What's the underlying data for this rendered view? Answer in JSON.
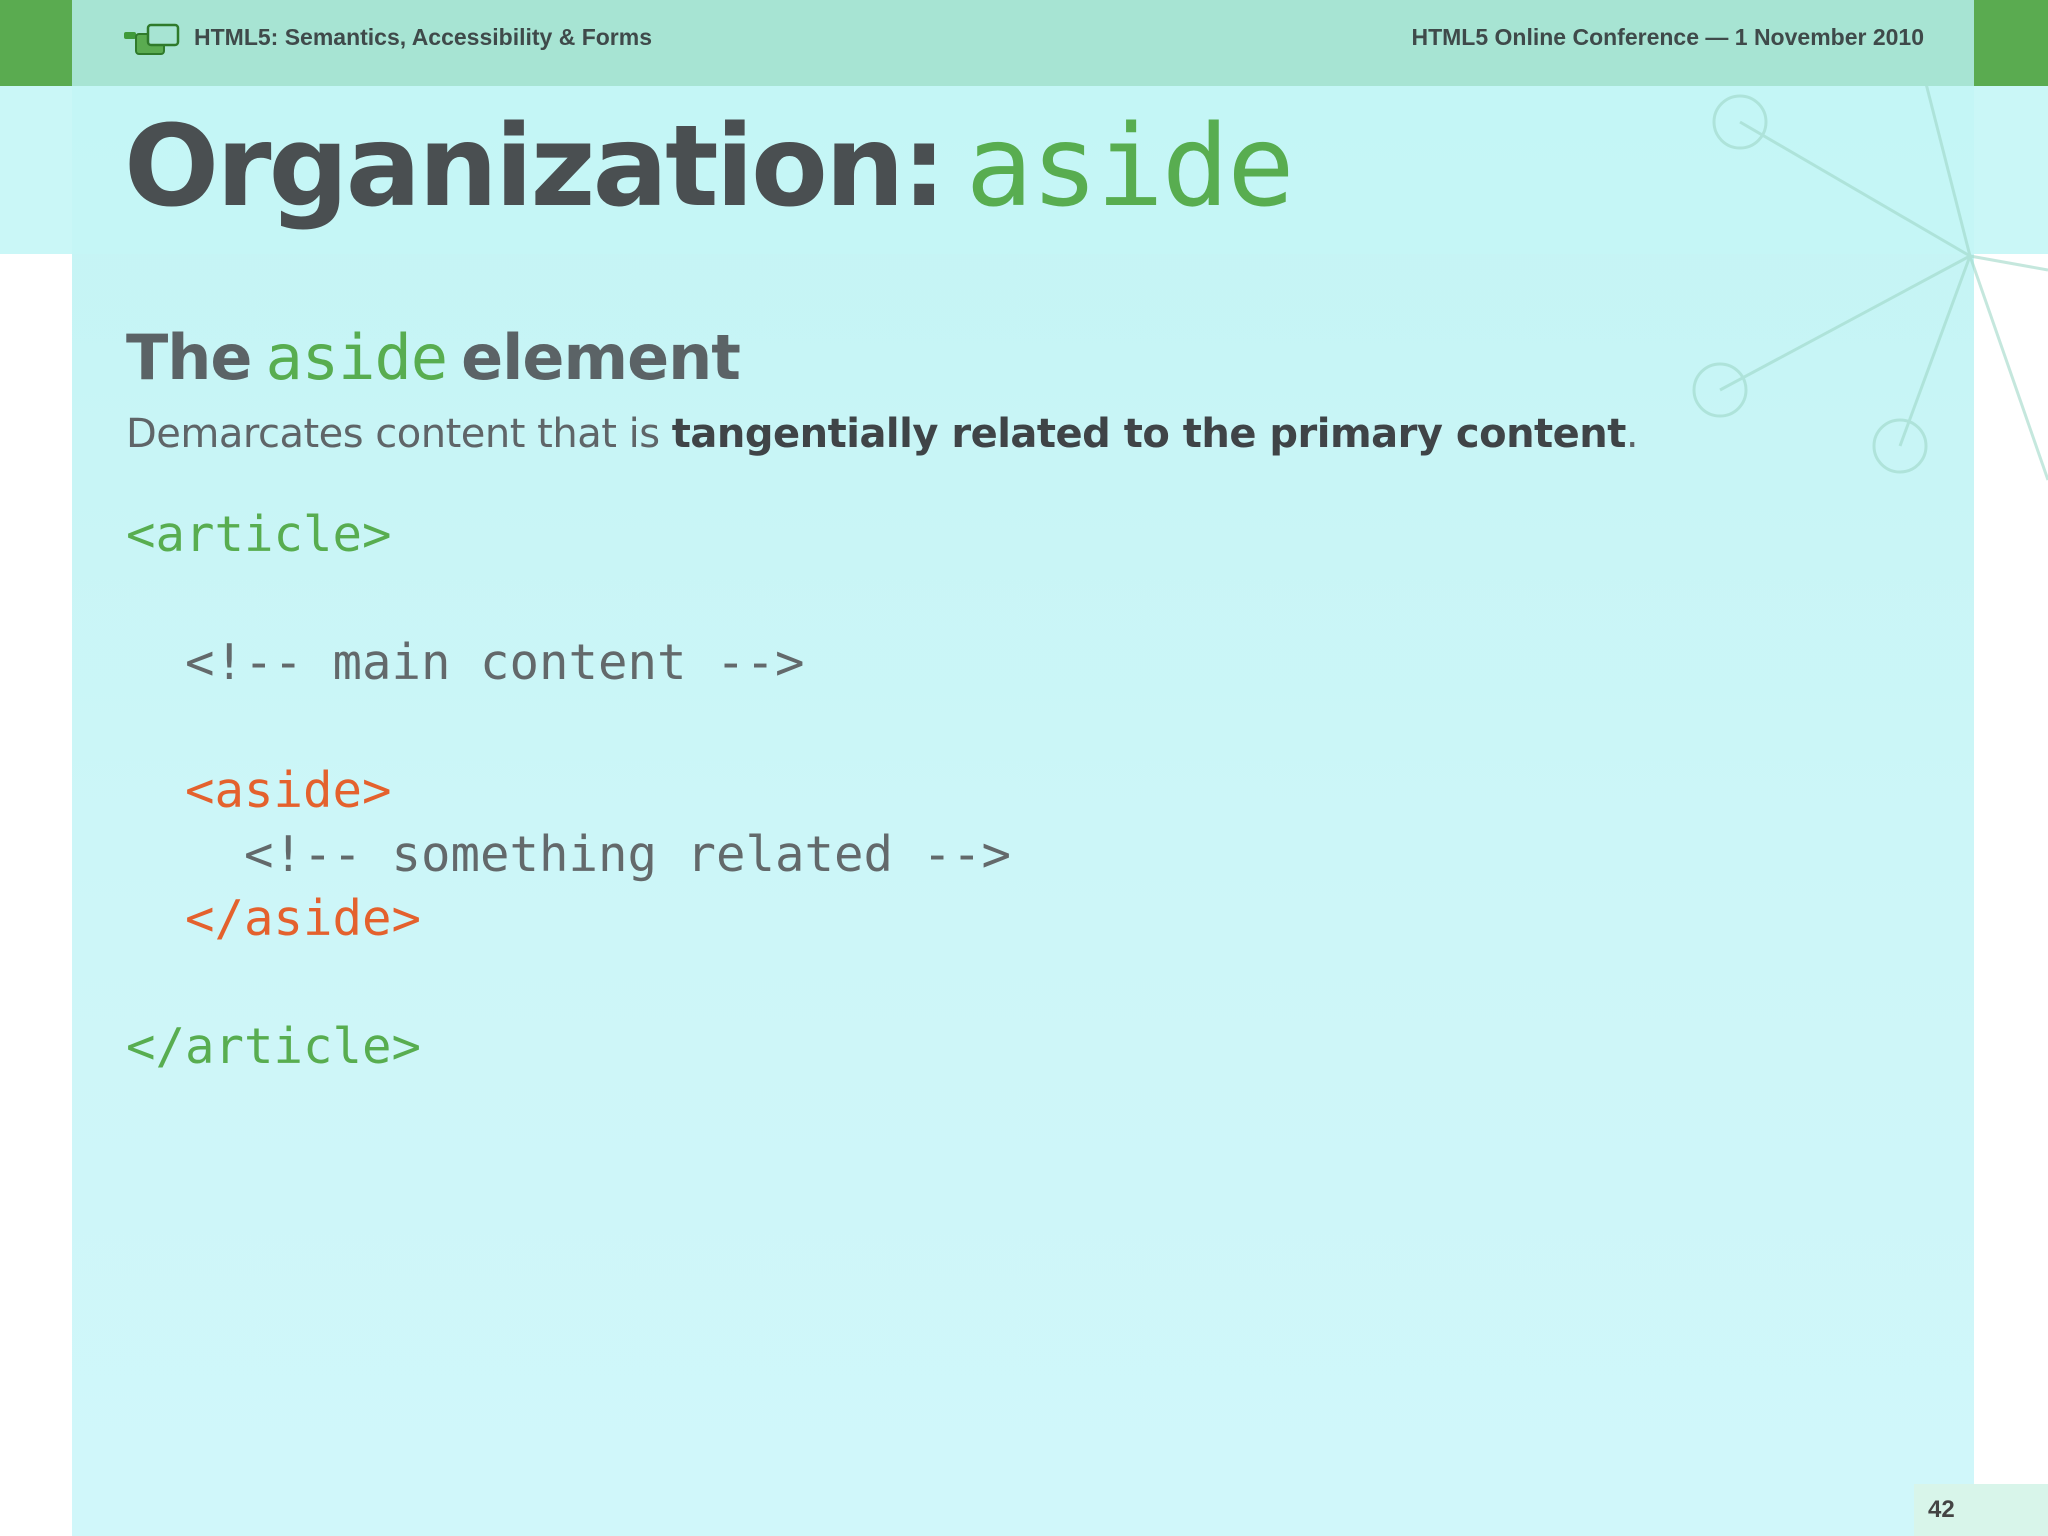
{
  "header": {
    "left_text": "HTML5: Semantics, Accessibility & Forms",
    "right_text": "HTML5 Online Conference — 1 November 2010",
    "logo_icon": "chat-bubbles-icon"
  },
  "title": {
    "main": "Organization:",
    "code": "aside"
  },
  "subheading": {
    "pre": "The",
    "code": "aside",
    "post": "element"
  },
  "description": {
    "plain": "Demarcates content that is ",
    "bold": "tangentially related to the primary content",
    "end": "."
  },
  "code_block": {
    "line1": "<article>",
    "line2": "",
    "line3": "  <!-- main content -->",
    "line4": "",
    "line5": "  <aside>",
    "line6": "    <!-- something related -->",
    "line7": "  </aside>",
    "line8": "",
    "line9": "</article>"
  },
  "page_number": "42",
  "colors": {
    "accent_green": "#58ad50",
    "header_bg": "#a7e4d3",
    "slide_bg": "#c3f4f4",
    "code_orange": "#e4612d",
    "text_dark": "#4a4f51"
  }
}
